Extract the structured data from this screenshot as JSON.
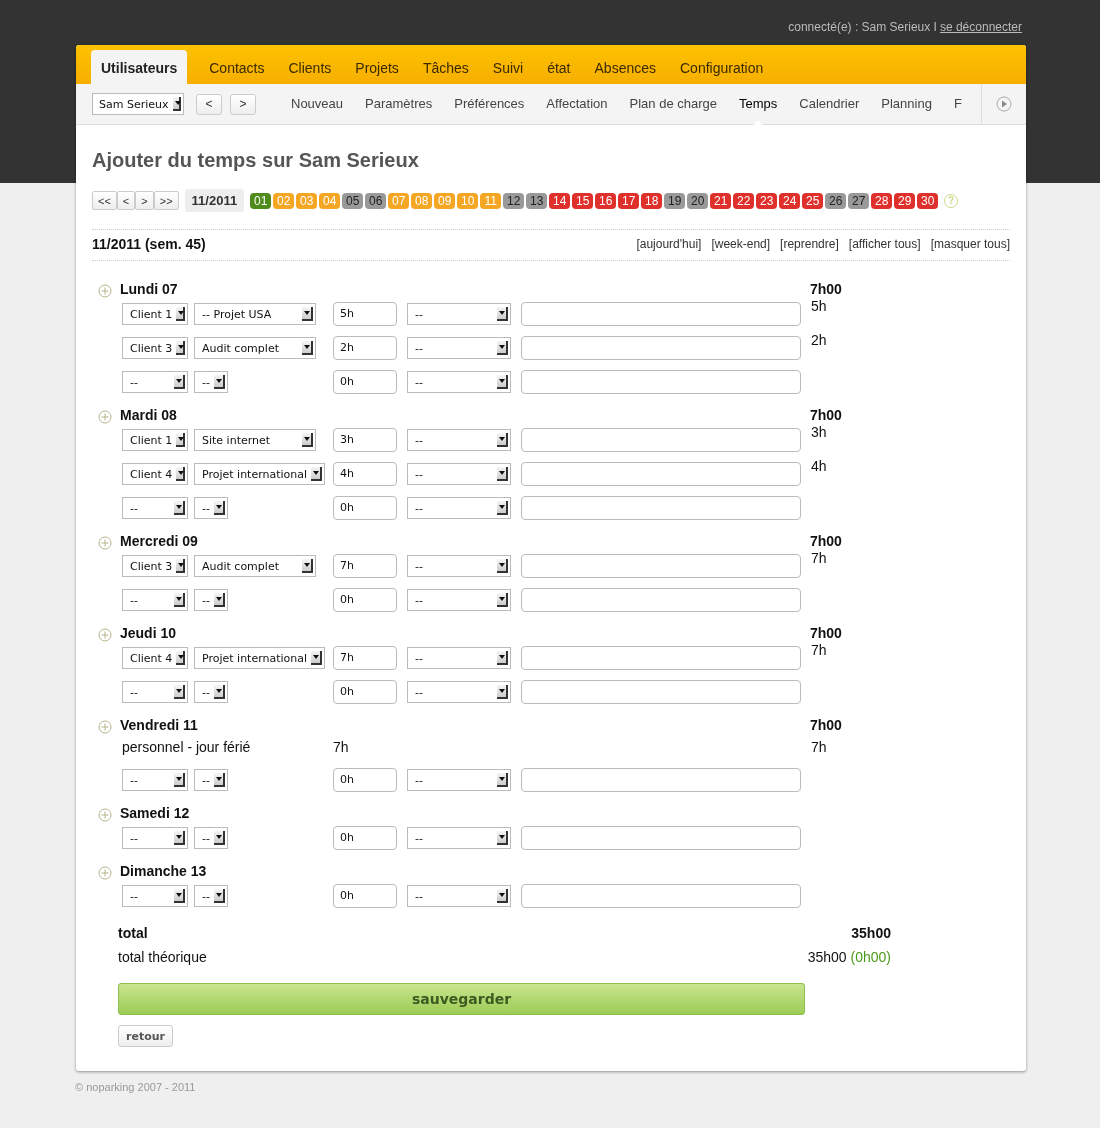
{
  "header": {
    "connected": "connecté(e) : Sam Serieux I",
    "logout": "se déconnecter"
  },
  "tabs": [
    {
      "label": "Utilisateurs",
      "selected": true
    },
    {
      "label": "Contacts",
      "selected": false
    },
    {
      "label": "Clients",
      "selected": false
    },
    {
      "label": "Projets",
      "selected": false
    },
    {
      "label": "Tâches",
      "selected": false
    },
    {
      "label": "Suivi",
      "selected": false
    },
    {
      "label": "état",
      "selected": false
    },
    {
      "label": "Absences",
      "selected": false
    },
    {
      "label": "Configuration",
      "selected": false
    }
  ],
  "subnav": {
    "user_select": "Sam Serieux",
    "prev": "<",
    "next": ">",
    "items": [
      {
        "label": "Nouveau",
        "selected": false
      },
      {
        "label": "Paramètres",
        "selected": false
      },
      {
        "label": "Préférences",
        "selected": false
      },
      {
        "label": "Affectation",
        "selected": false
      },
      {
        "label": "Plan de charge",
        "selected": false
      },
      {
        "label": "Temps",
        "selected": true
      },
      {
        "label": "Calendrier",
        "selected": false
      },
      {
        "label": "Planning",
        "selected": false
      },
      {
        "label": "F",
        "selected": false
      }
    ]
  },
  "title": "Ajouter du temps sur Sam Serieux",
  "period": {
    "nav": [
      "<<",
      "<",
      ">",
      ">>"
    ],
    "month": "11/2011",
    "help": "?",
    "days": [
      {
        "label": "01",
        "color": "#4f8a1c"
      },
      {
        "label": "02",
        "color": "#f5a623"
      },
      {
        "label": "03",
        "color": "#f5a623"
      },
      {
        "label": "04",
        "color": "#f5a623"
      },
      {
        "label": "05",
        "color": "#999999"
      },
      {
        "label": "06",
        "color": "#999999"
      },
      {
        "label": "07",
        "color": "#f5a623"
      },
      {
        "label": "08",
        "color": "#f5a623"
      },
      {
        "label": "09",
        "color": "#f5a623"
      },
      {
        "label": "10",
        "color": "#f5a623"
      },
      {
        "label": "11",
        "color": "#f5a623"
      },
      {
        "label": "12",
        "color": "#999999"
      },
      {
        "label": "13",
        "color": "#999999"
      },
      {
        "label": "14",
        "color": "#e0302b"
      },
      {
        "label": "15",
        "color": "#e0302b"
      },
      {
        "label": "16",
        "color": "#e0302b"
      },
      {
        "label": "17",
        "color": "#e0302b"
      },
      {
        "label": "18",
        "color": "#e0302b"
      },
      {
        "label": "19",
        "color": "#999999"
      },
      {
        "label": "20",
        "color": "#999999"
      },
      {
        "label": "21",
        "color": "#e0302b"
      },
      {
        "label": "22",
        "color": "#e0302b"
      },
      {
        "label": "23",
        "color": "#e0302b"
      },
      {
        "label": "24",
        "color": "#e0302b"
      },
      {
        "label": "25",
        "color": "#e0302b"
      },
      {
        "label": "26",
        "color": "#999999"
      },
      {
        "label": "27",
        "color": "#999999"
      },
      {
        "label": "28",
        "color": "#e0302b"
      },
      {
        "label": "29",
        "color": "#e0302b"
      },
      {
        "label": "30",
        "color": "#e0302b"
      }
    ]
  },
  "week": {
    "label": "11/2011 (sem. 45)",
    "links": [
      "[aujourd'hui]",
      "[week-end]",
      "[reprendre]",
      "[afficher tous]",
      "[masquer tous]"
    ]
  },
  "days": [
    {
      "label": "Lundi 07",
      "total": "7h00",
      "rows": [
        {
          "kind": "entry",
          "client": "Client 1",
          "project": "-- Projet USA",
          "hours": "5h",
          "activity": "--",
          "total": "5h"
        },
        {
          "kind": "entry",
          "client": "Client 3",
          "project": "Audit complet",
          "hours": "2h",
          "activity": "--",
          "total": "2h"
        },
        {
          "kind": "entry",
          "client": "--",
          "project": "--",
          "hours": "0h",
          "activity": "--"
        }
      ]
    },
    {
      "label": "Mardi 08",
      "total": "7h00",
      "rows": [
        {
          "kind": "entry",
          "client": "Client 1",
          "project": "Site internet",
          "hours": "3h",
          "activity": "--",
          "total": "3h"
        },
        {
          "kind": "entry",
          "client": "Client 4",
          "project": "Projet international",
          "hours": "4h",
          "activity": "--",
          "total": "4h"
        },
        {
          "kind": "entry",
          "client": "--",
          "project": "--",
          "hours": "0h",
          "activity": "--"
        }
      ]
    },
    {
      "label": "Mercredi 09",
      "total": "7h00",
      "rows": [
        {
          "kind": "entry",
          "client": "Client 3",
          "project": "Audit complet",
          "hours": "7h",
          "activity": "--",
          "total": "7h"
        },
        {
          "kind": "entry",
          "client": "--",
          "project": "--",
          "hours": "0h",
          "activity": "--"
        }
      ]
    },
    {
      "label": "Jeudi 10",
      "total": "7h00",
      "rows": [
        {
          "kind": "entry",
          "client": "Client 4",
          "project": "Projet international",
          "hours": "7h",
          "activity": "--",
          "total": "7h"
        },
        {
          "kind": "entry",
          "client": "--",
          "project": "--",
          "hours": "0h",
          "activity": "--"
        }
      ]
    },
    {
      "label": "Vendredi 11",
      "total": "7h00",
      "rows": [
        {
          "kind": "fixed",
          "label": "personnel - jour férié",
          "hours": "7h",
          "total": "7h"
        },
        {
          "kind": "entry",
          "client": "--",
          "project": "--",
          "hours": "0h",
          "activity": "--"
        }
      ]
    },
    {
      "label": "Samedi 12",
      "rows": [
        {
          "kind": "entry",
          "client": "--",
          "project": "--",
          "hours": "0h",
          "activity": "--"
        }
      ]
    },
    {
      "label": "Dimanche 13",
      "rows": [
        {
          "kind": "entry",
          "client": "--",
          "project": "--",
          "hours": "0h",
          "activity": "--"
        }
      ]
    }
  ],
  "totals": {
    "total_label": "total",
    "total": "35h00",
    "theoretical_label": "total théorique",
    "theoretical": "35h00",
    "difference": "(0h00)"
  },
  "save": "sauvegarder",
  "back": "retour",
  "footer": "© noparking 2007 - 2011"
}
